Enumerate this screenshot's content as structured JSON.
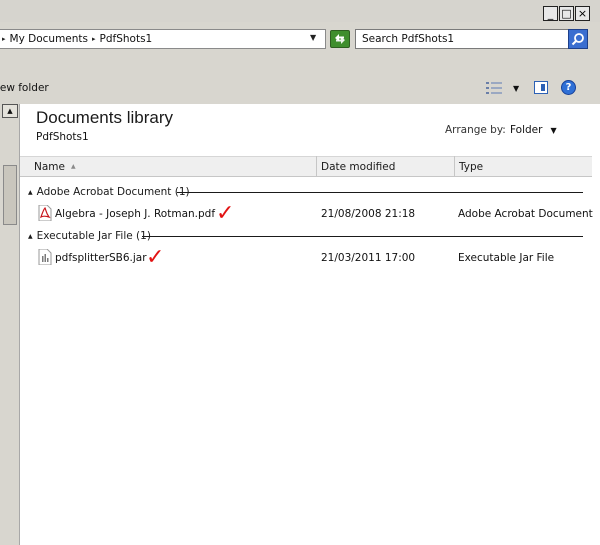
{
  "window": {
    "minimize_label": "_",
    "maximize_label": "□",
    "close_label": "×"
  },
  "address": {
    "crumbs": [
      "My Documents",
      "PdfShots1"
    ]
  },
  "search": {
    "placeholder": "Search PdfShots1"
  },
  "toolbar": {
    "new_folder_label": "New folder"
  },
  "library": {
    "title": "Documents library",
    "subtitle": "PdfShots1",
    "arrange_by_label": "Arrange by:",
    "arrange_by_value": "Folder"
  },
  "columns": {
    "name": "Name",
    "date_modified": "Date modified",
    "type": "Type"
  },
  "groups": [
    {
      "label": "Adobe Acrobat Document (1)",
      "files": [
        {
          "name": "Algebra - Joseph J. Rotman.pdf",
          "date": "21/08/2008 21:18",
          "type": "Adobe Acrobat Document",
          "icon": "pdf-file-icon"
        }
      ]
    },
    {
      "label": "Executable Jar File (1)",
      "files": [
        {
          "name": "pdfsplitterSB6.jar",
          "date": "21/03/2011 17:00",
          "type": "Executable Jar File",
          "icon": "jar-file-icon"
        }
      ]
    }
  ],
  "annotation": {
    "check_mark": "✓",
    "color": "#e21313"
  },
  "colors": {
    "accent_blue": "#2f70d6",
    "refresh_green": "#3f8e2d"
  }
}
